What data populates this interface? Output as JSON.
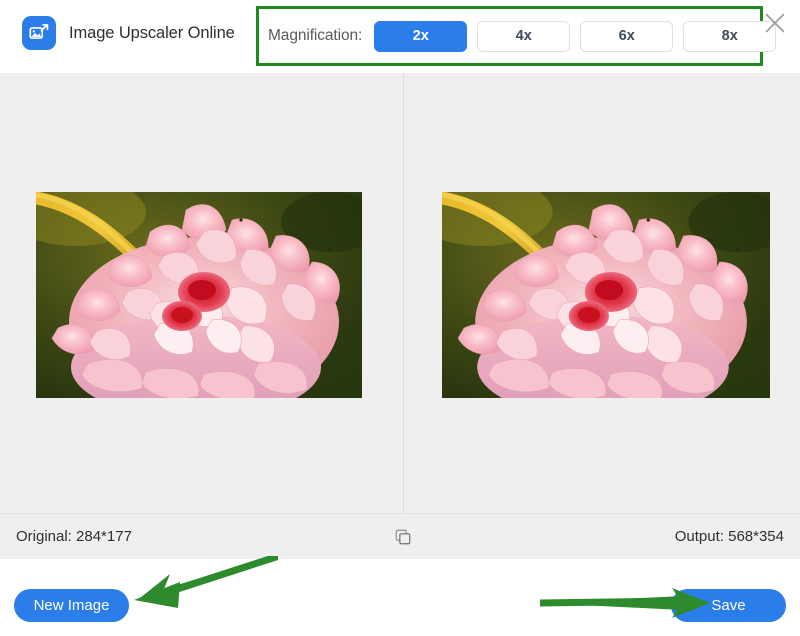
{
  "header": {
    "logo_icon": "image-upscale-icon",
    "title": "Image Upscaler Online",
    "close_icon": "close-icon",
    "magnification": {
      "label": "Magnification:",
      "selected": "2x",
      "options": [
        {
          "label": "2x",
          "selected": true
        },
        {
          "label": "4x",
          "selected": false
        },
        {
          "label": "6x",
          "selected": false
        },
        {
          "label": "8x",
          "selected": false
        }
      ],
      "highlight_color": "#1f8b1f",
      "accent_color": "#2b7de9"
    }
  },
  "preview": {
    "left_pane": {
      "name": "original-image-preview",
      "alt": "pink dahlia flower with yellow stem on dark green background"
    },
    "right_pane": {
      "name": "upscaled-image-preview",
      "alt": "pink dahlia flower with yellow stem on dark green background"
    },
    "compare_icon": "compare-square-icon"
  },
  "statusbar": {
    "original_label": "Original: 284*177",
    "output_label": "Output: 568*354"
  },
  "footer": {
    "new_image_label": "New Image",
    "save_label": "Save",
    "button_color": "#2b7de9"
  },
  "annotations": {
    "arrow_color": "#2d8a2d",
    "arrow_to_new_image": "green-arrow-icon",
    "arrow_to_save": "green-arrow-icon"
  }
}
